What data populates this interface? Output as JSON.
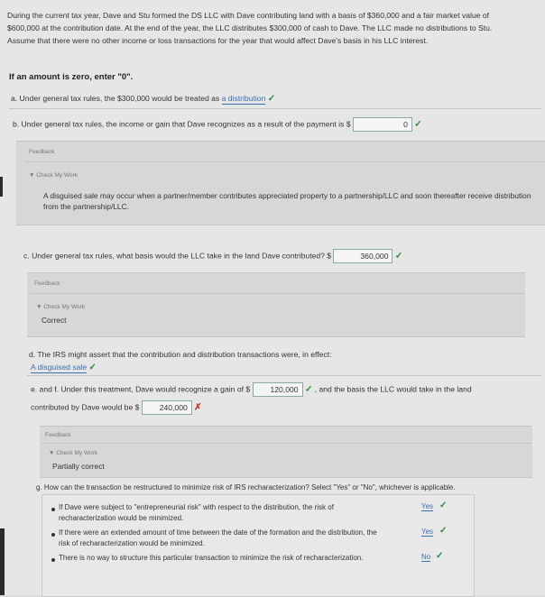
{
  "intro": "During the current tax year, Dave and Stu formed the DS LLC with Dave contributing land with a basis of $360,000 and a fair market value of $600,000 at the contribution date. At the end of the year, the LLC distributes $300,000 of cash to Dave. The LLC made no distributions to Stu. Assume that there were no other income or loss transactions for the year that would affect Dave's basis in his LLC interest.",
  "zero_note": "If an amount is zero, enter \"0\".",
  "a": {
    "prompt": "a.  Under general tax rules, the $300,000 would be treated as",
    "answer": "a distribution"
  },
  "b": {
    "prompt": "b.  Under general tax rules, the income or gain that Dave recognizes as a result of the payment is $",
    "value": "0"
  },
  "feedback_b": {
    "title": "Feedback",
    "check": "▼ Check My Work",
    "text": "A disguised sale may occur when a partner/member contributes appreciated property to a partnership/LLC and soon thereafter receive distribution from the partnership/LLC."
  },
  "c": {
    "prompt": "c.  Under general tax rules, what basis would the LLC take in the land Dave contributed?  $",
    "value": "360,000"
  },
  "feedback_c": {
    "title": "Feedback",
    "check": "▼ Check My Work",
    "text": "Correct"
  },
  "d": {
    "prompt": "d.  The IRS might assert that the contribution and distribution transactions were, in effect:",
    "answer": "A disguised sale"
  },
  "e": {
    "prompt1": "e. and f.  Under this treatment, Dave would recognize a gain of $",
    "value1": "120,000",
    "prompt2": ", and the basis the LLC would take in the land",
    "prompt3": "contributed by Dave would be $",
    "value2": "240,000"
  },
  "feedback_e": {
    "title": "Feedback",
    "check": "▼ Check My Work",
    "text": "Partially correct"
  },
  "g": {
    "prompt": "g.  How can the transaction be restructured to minimize risk of IRS recharacterization? Select \"Yes\" or \"No\", whichever is applicable.",
    "items": [
      {
        "line1": "If Dave were subject to \"entrepreneurial risk\" with respect to the distribution, the risk of",
        "line2": "recharacterization would be minimized.",
        "answer": "Yes"
      },
      {
        "line1": "If there were an extended amount of time between the date of the formation and the distribution, the",
        "line2": "risk of recharacterization would be minimized.",
        "answer": "Yes"
      },
      {
        "line1": "There is no way to structure this particular transaction to minimize the risk of recharacterization.",
        "line2": "",
        "answer": "No"
      }
    ]
  },
  "marks": {
    "check": "✓",
    "cross": "✗"
  }
}
